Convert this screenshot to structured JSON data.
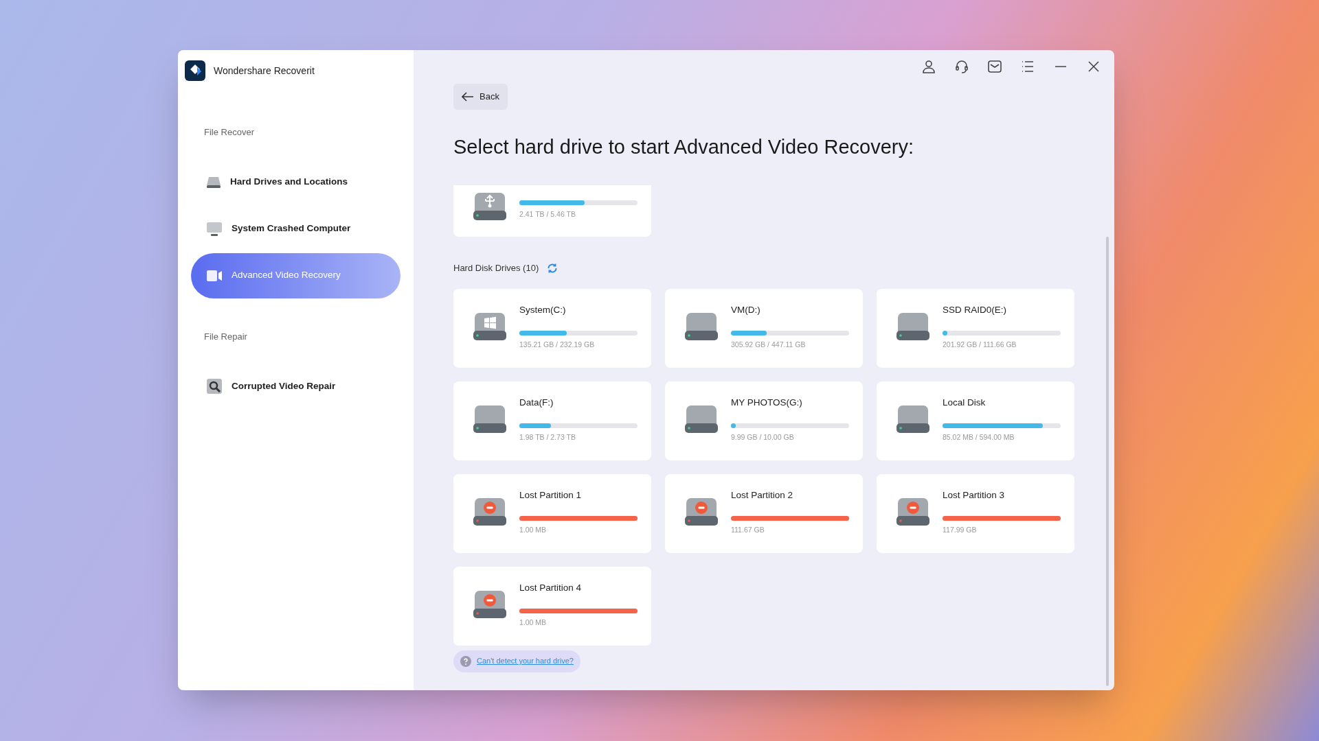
{
  "app": {
    "title": "Wondershare Recoverit"
  },
  "sidebar": {
    "sections": [
      {
        "heading": "File Recover",
        "items": [
          {
            "label": "Hard Drives and Locations",
            "kind": "drive",
            "selected": false
          },
          {
            "label": "System Crashed Computer",
            "kind": "monitor",
            "selected": false
          },
          {
            "label": "Advanced Video Recovery",
            "kind": "video",
            "selected": true
          }
        ]
      },
      {
        "heading": "File Repair",
        "items": [
          {
            "label": "Corrupted Video Repair",
            "kind": "repair",
            "selected": false
          }
        ]
      }
    ]
  },
  "back_button": "Back",
  "heading": "Select hard drive to start Advanced Video Recovery:",
  "partial_drive": {
    "kind": "usb",
    "level": 0.55,
    "size": "2.41 TB / 5.46 TB"
  },
  "group": {
    "title": "Hard Disk Drives (10)"
  },
  "drives": [
    {
      "name": "System(C:)",
      "kind": "windows",
      "level": 0.4,
      "size": "135.21 GB / 232.19 GB"
    },
    {
      "name": "VM(D:)",
      "kind": "plain",
      "level": 0.3,
      "size": "305.92 GB / 447.11 GB"
    },
    {
      "name": "SSD RAID0(E:)",
      "kind": "plain",
      "level": 0.04,
      "size": "201.92 GB / 111.66 GB"
    },
    {
      "name": "Data(F:)",
      "kind": "plain",
      "level": 0.27,
      "size": "1.98 TB / 2.73 TB"
    },
    {
      "name": "MY PHOTOS(G:)",
      "kind": "plain",
      "level": 0.04,
      "size": "9.99 GB / 10.00 GB"
    },
    {
      "name": "Local Disk",
      "kind": "plain",
      "level": 0.85,
      "size": "85.02 MB / 594.00 MB"
    },
    {
      "name": "Lost Partition 1",
      "kind": "lost",
      "level": 1,
      "size": "1.00 MB"
    },
    {
      "name": "Lost Partition 2",
      "kind": "lost",
      "level": 1,
      "size": "111.67 GB"
    },
    {
      "name": "Lost Partition 3",
      "kind": "lost",
      "level": 1,
      "size": "117.99 GB"
    },
    {
      "name": "Lost Partition 4",
      "kind": "lost",
      "level": 1,
      "size": "1.00 MB"
    }
  ],
  "help_link": "Can't detect your hard drive?"
}
